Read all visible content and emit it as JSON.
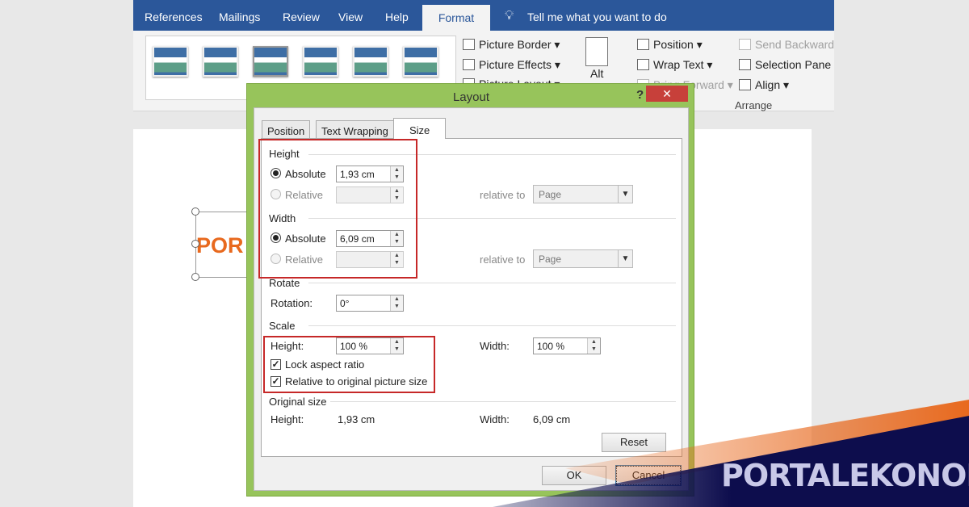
{
  "ribbon_tabs": [
    "References",
    "Mailings",
    "Review",
    "View",
    "Help"
  ],
  "active_tab": "Format",
  "tell_me": "Tell me what you want to do",
  "ribbon": {
    "picture_border": "Picture Border",
    "picture_effects": "Picture Effects",
    "picture_layout": "Picture Layout",
    "alt": "Alt",
    "position": "Position",
    "wrap_text": "Wrap Text",
    "bring_forward": "Bring Forward",
    "send_backward": "Send Backward",
    "selection_pane": "Selection Pane",
    "align": "Align",
    "arrange": "Arrange"
  },
  "doc_logo_text": "POR",
  "dialog": {
    "title": "Layout",
    "help": "?",
    "close": "✕",
    "tabs": [
      "Position",
      "Text Wrapping",
      "Size"
    ],
    "active_tab": "Size",
    "height": {
      "section": "Height",
      "absolute_label": "Absolute",
      "absolute_value": "1,93 cm",
      "relative_label": "Relative",
      "relative_to": "relative to",
      "relative_to_value": "Page",
      "selected": "Absolute"
    },
    "width": {
      "section": "Width",
      "absolute_label": "Absolute",
      "absolute_value": "6,09 cm",
      "relative_label": "Relative",
      "relative_to": "relative to",
      "relative_to_value": "Page",
      "selected": "Absolute"
    },
    "rotate": {
      "section": "Rotate",
      "rotation_label": "Rotation:",
      "rotation_value": "0°"
    },
    "scale": {
      "section": "Scale",
      "height_label": "Height:",
      "height_value": "100 %",
      "width_label": "Width:",
      "width_value": "100 %",
      "lock_aspect": "Lock aspect ratio",
      "lock_aspect_checked": true,
      "relative_original": "Relative to original picture size",
      "relative_original_checked": true
    },
    "original": {
      "section": "Original size",
      "height_label": "Height:",
      "height_value": "1,93 cm",
      "width_label": "Width:",
      "width_value": "6,09 cm"
    },
    "reset": "Reset",
    "ok": "OK",
    "cancel": "Cancel"
  },
  "watermark": "PORTALEKONOMI",
  "colors": {
    "ribbon_blue": "#2b579a",
    "dialog_green": "#97c45b",
    "highlight_red": "#c62828",
    "banner_navy": "#0d0d4d",
    "banner_orange": "#e8691e"
  }
}
